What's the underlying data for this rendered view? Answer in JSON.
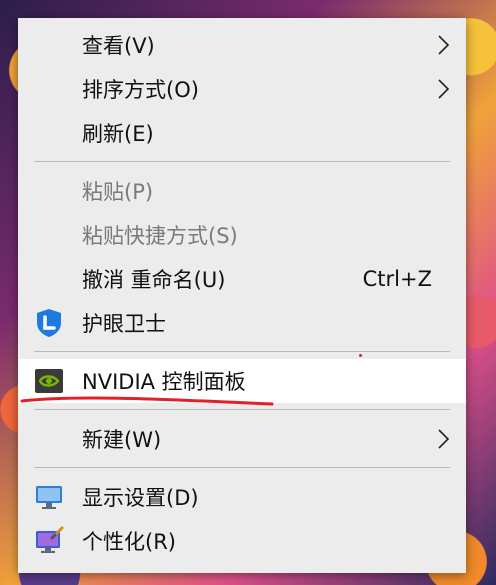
{
  "menu": {
    "view": {
      "label": "查看(V)"
    },
    "sort": {
      "label": "排序方式(O)"
    },
    "refresh": {
      "label": "刷新(E)"
    },
    "paste": {
      "label": "粘贴(P)"
    },
    "paste_shortcut": {
      "label": "粘贴快捷方式(S)"
    },
    "undo_rename": {
      "label": "撤消 重命名(U)",
      "shortcut": "Ctrl+Z"
    },
    "eye_care": {
      "label": "护眼卫士",
      "icon": "shield-icon"
    },
    "nvidia": {
      "label": "NVIDIA 控制面板",
      "icon": "nvidia-icon"
    },
    "new": {
      "label": "新建(W)"
    },
    "display": {
      "label": "显示设置(D)",
      "icon": "monitor-icon"
    },
    "personalize": {
      "label": "个性化(R)",
      "icon": "personalize-icon"
    }
  },
  "colors": {
    "menu_bg": "#ececec",
    "hover_bg": "#ffffff",
    "annotation_red": "#e0202a",
    "nvidia_green": "#76b900"
  }
}
